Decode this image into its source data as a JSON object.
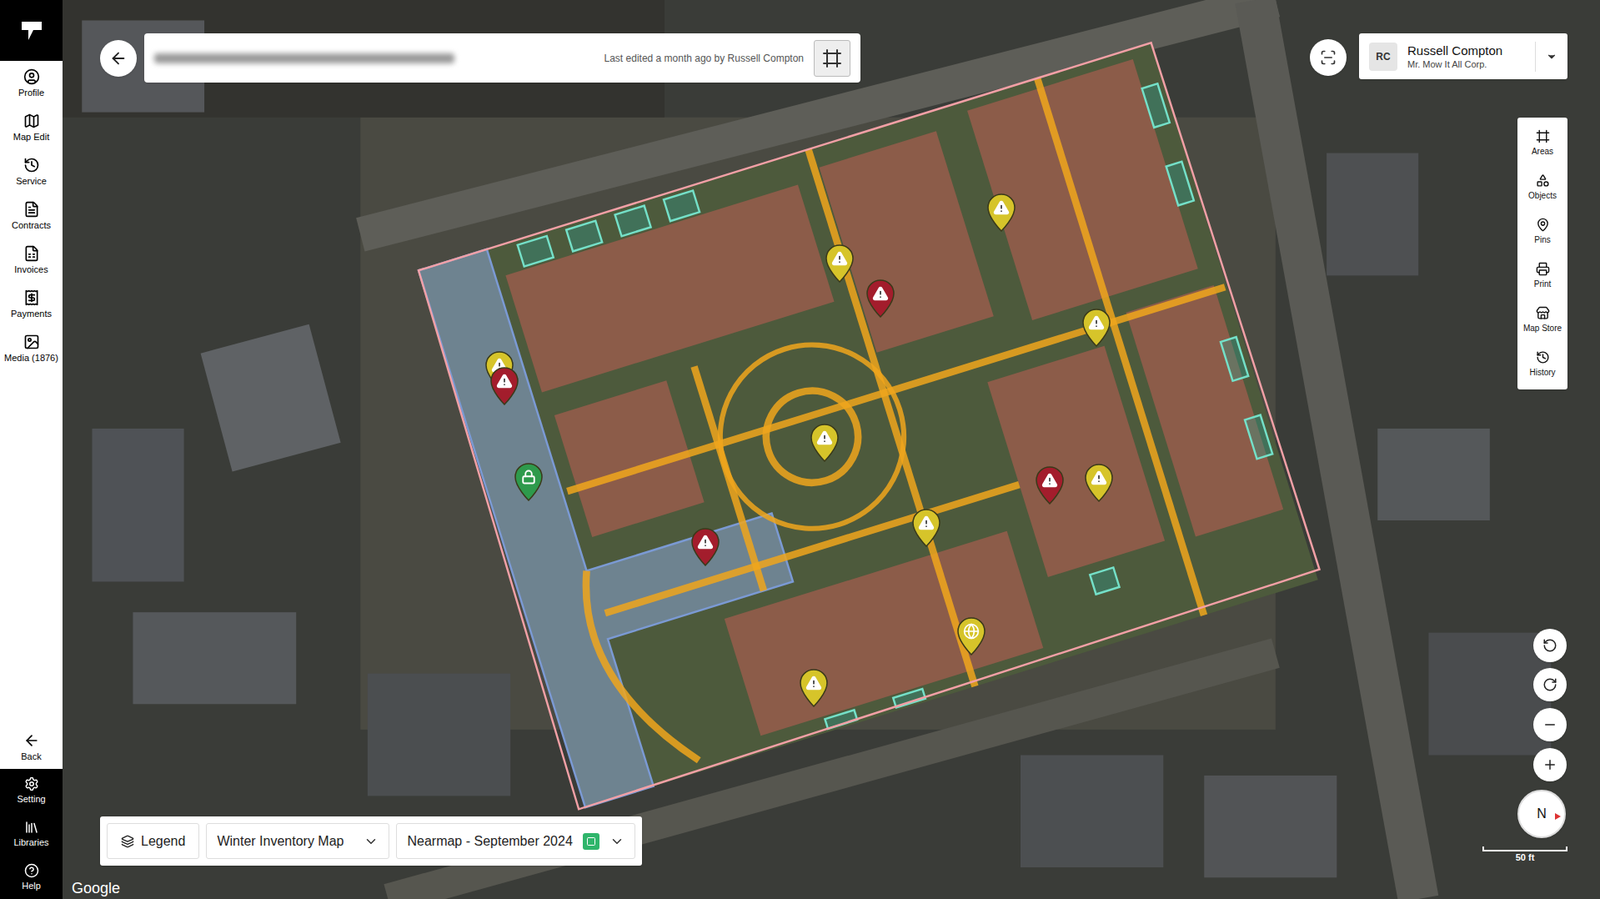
{
  "sidebar": {
    "items": [
      {
        "label": "Profile"
      },
      {
        "label": "Map Edit"
      },
      {
        "label": "Service"
      },
      {
        "label": "Contracts"
      },
      {
        "label": "Invoices"
      },
      {
        "label": "Payments"
      },
      {
        "label": "Media (1876)"
      }
    ],
    "back": "Back",
    "bottom_items": [
      {
        "label": "Setting"
      },
      {
        "label": "Libraries"
      },
      {
        "label": "Help"
      }
    ]
  },
  "header": {
    "last_edited": "Last edited a month ago by Russell Compton"
  },
  "user": {
    "initials": "RC",
    "name": "Russell Compton",
    "company": "Mr. Mow It All Corp."
  },
  "toolbar": [
    {
      "label": "Areas"
    },
    {
      "label": "Objects"
    },
    {
      "label": "Pins"
    },
    {
      "label": "Print"
    },
    {
      "label": "Map Store"
    },
    {
      "label": "History"
    }
  ],
  "pins": [
    {
      "kind": "warning",
      "color": "#d6c42a"
    },
    {
      "kind": "warning",
      "color": "#a31d2c"
    },
    {
      "kind": "warning",
      "color": "#d6c42a"
    },
    {
      "kind": "warning",
      "color": "#d6c42a"
    },
    {
      "kind": "warning",
      "color": "#d6c42a"
    },
    {
      "kind": "warning",
      "color": "#a31d2c"
    },
    {
      "kind": "lock",
      "color": "#2e9a4c"
    },
    {
      "kind": "warning",
      "color": "#d6c42a"
    },
    {
      "kind": "warning",
      "color": "#a31d2c"
    },
    {
      "kind": "warning",
      "color": "#d6c42a"
    },
    {
      "kind": "warning",
      "color": "#d6c42a"
    },
    {
      "kind": "warning",
      "color": "#a31d2c"
    },
    {
      "kind": "marker",
      "color": "#d6c42a"
    },
    {
      "kind": "warning",
      "color": "#d6c42a"
    }
  ],
  "bottom_bar": {
    "legend": "Legend",
    "map_name": "Winter Inventory Map",
    "imagery": "Nearmap - September 2024"
  },
  "scale": "50 ft",
  "compass": "N",
  "attribution": "Google"
}
